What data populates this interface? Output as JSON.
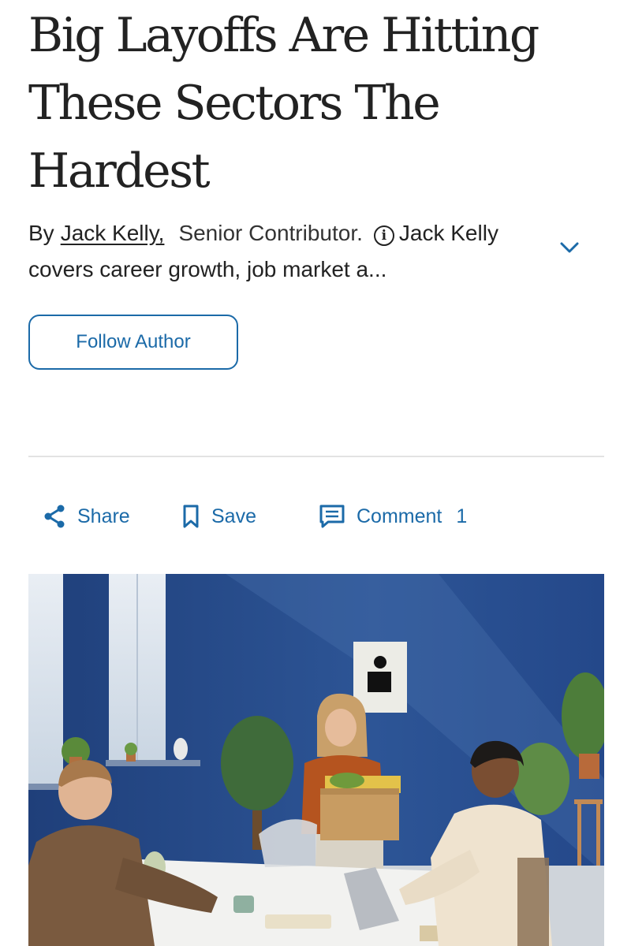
{
  "article": {
    "headline_lines": [
      "Big Layoffs Are Hitting",
      "These Sectors The",
      "Hardest"
    ]
  },
  "byline": {
    "by": "By",
    "author": "Jack Kelly,",
    "title": "Senior Contributor.",
    "bio": "Jack Kelly covers career growth, job market a..."
  },
  "follow_button": "Follow Author",
  "actions": {
    "share": "Share",
    "save": "Save",
    "comment": "Comment",
    "comment_count": "1"
  },
  "colors": {
    "accent": "#1b6aa8",
    "wall": "#2b4f8f"
  },
  "icons": [
    "info-icon",
    "chevron-down-icon",
    "share-icon",
    "bookmark-icon",
    "comment-icon"
  ]
}
